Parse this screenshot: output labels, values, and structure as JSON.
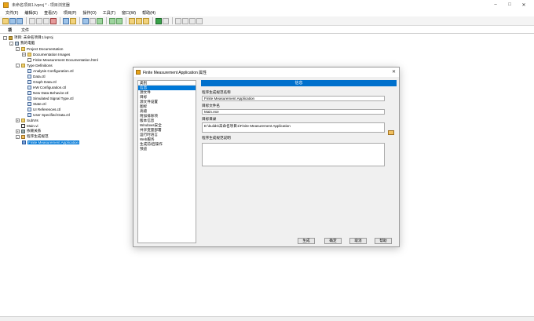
{
  "window": {
    "title": "未命名项目1.lvproj * - 项目浏览器"
  },
  "menu": [
    "文件(F)",
    "编辑(E)",
    "查看(V)",
    "项目(P)",
    "操作(O)",
    "工具(T)",
    "窗口(W)",
    "帮助(H)"
  ],
  "tabs": [
    "项",
    "文件"
  ],
  "tree": [
    {
      "label": "项目: 未命名项目1.lvproj",
      "icon": "project-icon"
    },
    {
      "label": "我的电脑",
      "icon": "computer-icon"
    },
    {
      "label": "Project Documentation",
      "icon": "folder-icon"
    },
    {
      "label": "Documentation Images",
      "icon": "folder-icon"
    },
    {
      "label": "Finite Measurement Documentation.html",
      "icon": "html-file-icon"
    },
    {
      "label": "Type Definitions",
      "icon": "folder-icon"
    },
    {
      "label": "Analysis Configuration.ctl",
      "icon": "ctl-file-icon"
    },
    {
      "label": "Data.ctl",
      "icon": "ctl-file-icon"
    },
    {
      "label": "Graph Data.ctl",
      "icon": "ctl-file-icon"
    },
    {
      "label": "HW Configuration.ctl",
      "icon": "ctl-file-icon"
    },
    {
      "label": "New Data Behavior.ctl",
      "icon": "ctl-file-icon"
    },
    {
      "label": "Simulated Signal Type.ctl",
      "icon": "ctl-file-icon"
    },
    {
      "label": "State.ctl",
      "icon": "ctl-file-icon"
    },
    {
      "label": "UI References.ctl",
      "icon": "ctl-file-icon"
    },
    {
      "label": "User Specified Data.ctl",
      "icon": "ctl-file-icon"
    },
    {
      "label": "SubVIs",
      "icon": "folder-icon"
    },
    {
      "label": "Main.vi",
      "icon": "vi-file-icon"
    },
    {
      "label": "依赖关系",
      "icon": "dependencies-icon"
    },
    {
      "label": "程序生成规范",
      "icon": "build-spec-icon"
    },
    {
      "label": "Finite Measurement Application",
      "icon": "application-icon"
    }
  ],
  "dialog": {
    "title": "Finite Measurement Application 属性",
    "categories_header": "类别",
    "categories": [
      "信息",
      "源文件",
      "目标",
      "源文件设置",
      "图标",
      "高级",
      "附加排除项",
      "版本信息",
      "Windows安全",
      "共享变量部署",
      "运行时语言",
      "Web服务",
      "生成前/后操作",
      "预览"
    ],
    "selected_category": "信息",
    "info_header": "信息",
    "spec_name_label": "程序生成规范名称",
    "spec_name_value": "Finite Measurement Application",
    "target_file_label": "目标文件名",
    "target_file_value": "Main.exe",
    "target_dir_label": "目标目录",
    "target_dir_value": "E:\\builds\\未命名项目1\\Finite Measurement Application",
    "description_label": "程序生成规范说明",
    "description_value": "",
    "buttons": {
      "build": "生成",
      "ok": "确定",
      "cancel": "取消",
      "help": "帮助"
    }
  },
  "colors": {
    "selection": "#0078d7",
    "info_header": "#0070cc"
  }
}
